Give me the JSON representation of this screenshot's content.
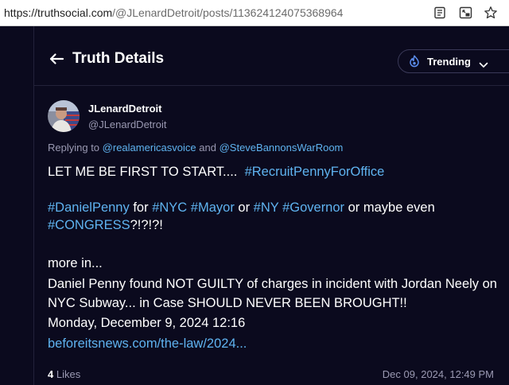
{
  "browser": {
    "url_host": "https://truthsocial.com",
    "url_path": "/@JLenardDetroit/posts/113624124075368964"
  },
  "header": {
    "title": "Truth Details",
    "filter_label": "Trending"
  },
  "post": {
    "display_name": "JLenardDetroit",
    "handle": "@JLenardDetroit",
    "replying_prefix": "Replying to",
    "replying_to": [
      "@realamericasvoice",
      "@SteveBannonsWarRoom"
    ],
    "replying_joiner": "and",
    "line1_text": "LET ME BE FIRST TO START....",
    "line1_tag": "#RecruitPennyForOffice",
    "line2_segments": [
      {
        "text": "#DanielPenny",
        "tag": true
      },
      {
        "text": " for ",
        "tag": false
      },
      {
        "text": "#NYC",
        "tag": true
      },
      {
        "text": " ",
        "tag": false
      },
      {
        "text": "#Mayor",
        "tag": true
      },
      {
        "text": " or ",
        "tag": false
      },
      {
        "text": "#NY",
        "tag": true
      },
      {
        "text": " ",
        "tag": false
      },
      {
        "text": "#Governor",
        "tag": true
      },
      {
        "text": " or maybe even ",
        "tag": false
      },
      {
        "text": "#CONGRESS",
        "tag": true
      },
      {
        "text": "?!?!?!",
        "tag": false
      }
    ],
    "more_in": "more in...",
    "headline": "Daniel Penny found NOT GUILTY of charges in incident with Jordan Neely on NYC Subway... in Case SHOULD NEVER BEEN BROUGHT!!",
    "date_line": "Monday, December 9, 2024 12:16",
    "link_text": "beforeitsnews.com/the-law/2024...",
    "likes_count": "4",
    "likes_label": "Likes",
    "timestamp": "Dec 09, 2024, 12:49 PM"
  },
  "colors": {
    "background": "#0b0a1e",
    "link": "#5fb3f0",
    "muted": "#9a99b2",
    "trending_icon": "#5b8def"
  },
  "icons": {
    "reader": "reader-view-icon",
    "pip": "picture-in-picture-icon",
    "favorite": "star-icon",
    "back": "arrow-left-icon",
    "trending": "flame-icon",
    "dropdown": "chevron-down-icon"
  }
}
